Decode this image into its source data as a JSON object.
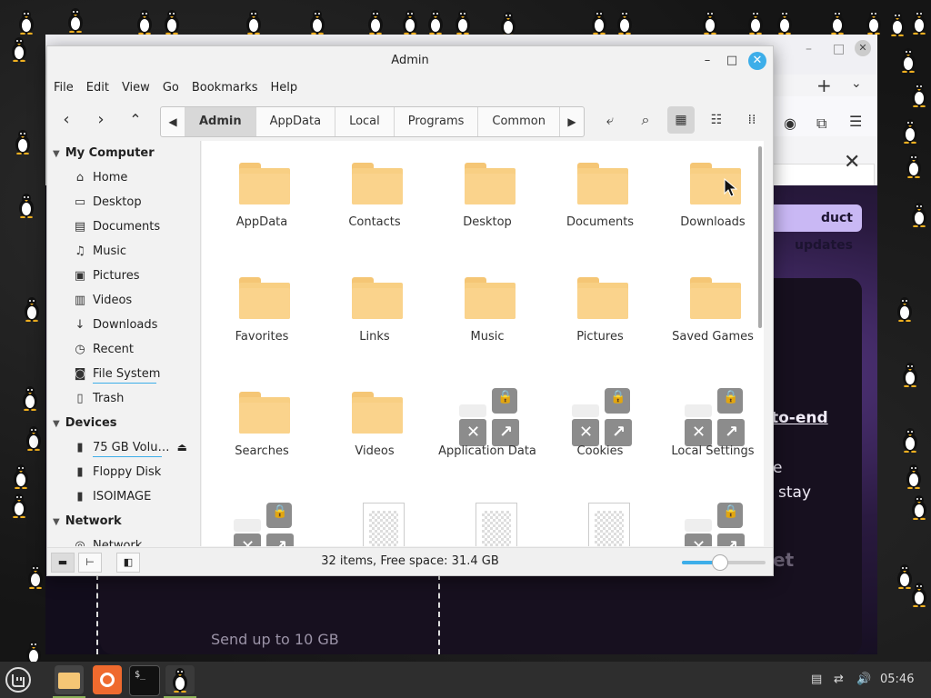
{
  "file_manager": {
    "title": "Admin",
    "window_buttons": {
      "minimize": "–",
      "maximize": "□",
      "close": "✕"
    },
    "menu": [
      "File",
      "Edit",
      "View",
      "Go",
      "Bookmarks",
      "Help"
    ],
    "breadcrumbs": [
      "Admin",
      "AppData",
      "Local",
      "Programs",
      "Common"
    ],
    "sidebar": {
      "sections": [
        {
          "title": "My Computer",
          "items": [
            {
              "label": "Home",
              "icon": "home-icon"
            },
            {
              "label": "Desktop",
              "icon": "desktop-icon"
            },
            {
              "label": "Documents",
              "icon": "documents-icon"
            },
            {
              "label": "Music",
              "icon": "music-icon"
            },
            {
              "label": "Pictures",
              "icon": "pictures-icon"
            },
            {
              "label": "Videos",
              "icon": "videos-icon"
            },
            {
              "label": "Downloads",
              "icon": "downloads-icon"
            },
            {
              "label": "Recent",
              "icon": "recent-icon"
            },
            {
              "label": "File System",
              "icon": "filesystem-icon"
            },
            {
              "label": "Trash",
              "icon": "trash-icon"
            }
          ]
        },
        {
          "title": "Devices",
          "items": [
            {
              "label": "75 GB Volu…",
              "icon": "drive-icon"
            },
            {
              "label": "Floppy Disk",
              "icon": "drive-icon"
            },
            {
              "label": "ISOIMAGE",
              "icon": "drive-icon"
            }
          ]
        },
        {
          "title": "Network",
          "items": [
            {
              "label": "Network",
              "icon": "network-icon"
            }
          ]
        }
      ]
    },
    "items": [
      {
        "label": "AppData",
        "type": "folder"
      },
      {
        "label": "Contacts",
        "type": "folder"
      },
      {
        "label": "Desktop",
        "type": "folder"
      },
      {
        "label": "Documents",
        "type": "folder"
      },
      {
        "label": "Downloads",
        "type": "folder"
      },
      {
        "label": "Favorites",
        "type": "folder"
      },
      {
        "label": "Links",
        "type": "folder"
      },
      {
        "label": "Music",
        "type": "folder"
      },
      {
        "label": "Pictures",
        "type": "folder"
      },
      {
        "label": "Saved Games",
        "type": "folder"
      },
      {
        "label": "Searches",
        "type": "folder"
      },
      {
        "label": "Videos",
        "type": "folder"
      },
      {
        "label": "Application Data",
        "type": "locked-link"
      },
      {
        "label": "Cookies",
        "type": "locked-link"
      },
      {
        "label": "Local Settings",
        "type": "locked-link"
      },
      {
        "label": "",
        "type": "locked-link"
      },
      {
        "label": "",
        "type": "unknown-file"
      },
      {
        "label": "",
        "type": "unknown-file"
      },
      {
        "label": "",
        "type": "unknown-file"
      },
      {
        "label": "",
        "type": "locked-link"
      }
    ],
    "status": "32 items, Free space: 31.4 GB",
    "zoom_fraction": 0.45
  },
  "browser_background": {
    "button": "duct updates",
    "line1": "to-end",
    "line2": "e",
    "line3": "stay",
    "line4": "et",
    "send_up": "Send up to 10 GB"
  },
  "taskbar": {
    "clock": "05:46"
  }
}
